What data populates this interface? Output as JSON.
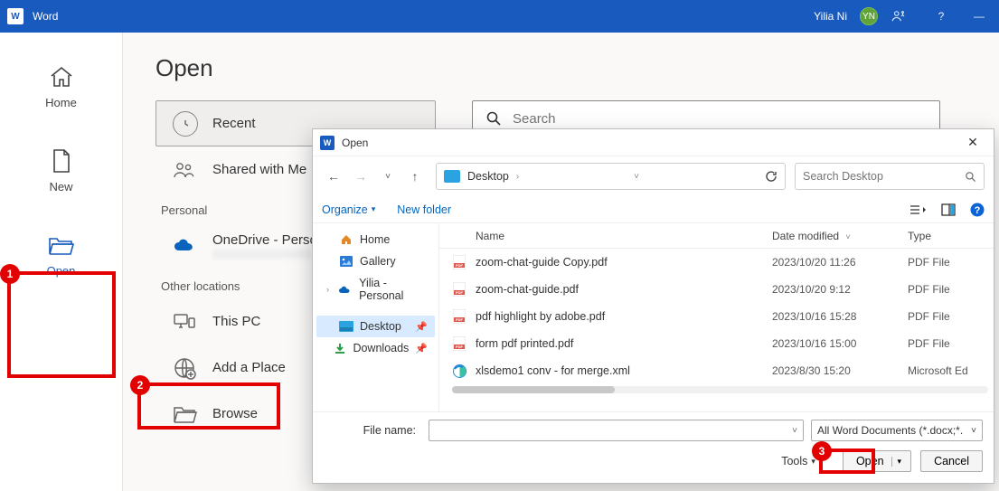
{
  "titlebar": {
    "app_name": "Word",
    "user_name": "Yilia Ni",
    "user_initials": "YN"
  },
  "nav": {
    "home": "Home",
    "new": "New",
    "open": "Open"
  },
  "page": {
    "title": "Open"
  },
  "places": {
    "recent": "Recent",
    "shared": "Shared with Me",
    "personal_label": "Personal",
    "onedrive": "OneDrive - Perso…",
    "other_label": "Other locations",
    "this_pc": "This PC",
    "add_place": "Add a Place",
    "browse": "Browse"
  },
  "search": {
    "placeholder": "Search"
  },
  "dialog": {
    "title": "Open",
    "breadcrumb": "Desktop",
    "search_placeholder": "Search Desktop",
    "organize": "Organize",
    "new_folder": "New folder",
    "tree": {
      "home": "Home",
      "gallery": "Gallery",
      "personal": "Yilia - Personal",
      "desktop": "Desktop",
      "downloads": "Downloads"
    },
    "columns": {
      "name": "Name",
      "date": "Date modified",
      "type": "Type"
    },
    "files": [
      {
        "icon": "pdf",
        "name": "zoom-chat-guide Copy.pdf",
        "date": "2023/10/20 11:26",
        "type": "PDF File"
      },
      {
        "icon": "pdf",
        "name": "zoom-chat-guide.pdf",
        "date": "2023/10/20 9:12",
        "type": "PDF File"
      },
      {
        "icon": "pdf",
        "name": "pdf highlight by adobe.pdf",
        "date": "2023/10/16 15:28",
        "type": "PDF File"
      },
      {
        "icon": "pdf",
        "name": "form pdf printed.pdf",
        "date": "2023/10/16 15:00",
        "type": "PDF File"
      },
      {
        "icon": "edge",
        "name": "xlsdemo1 conv - for merge.xml",
        "date": "2023/8/30 15:20",
        "type": "Microsoft Ed"
      }
    ],
    "filename_label": "File name:",
    "filter": "All Word Documents (*.docx;*.",
    "tools": "Tools",
    "open_btn": "Open",
    "cancel_btn": "Cancel"
  },
  "annotations": {
    "a1": "1",
    "a2": "2",
    "a3": "3"
  }
}
